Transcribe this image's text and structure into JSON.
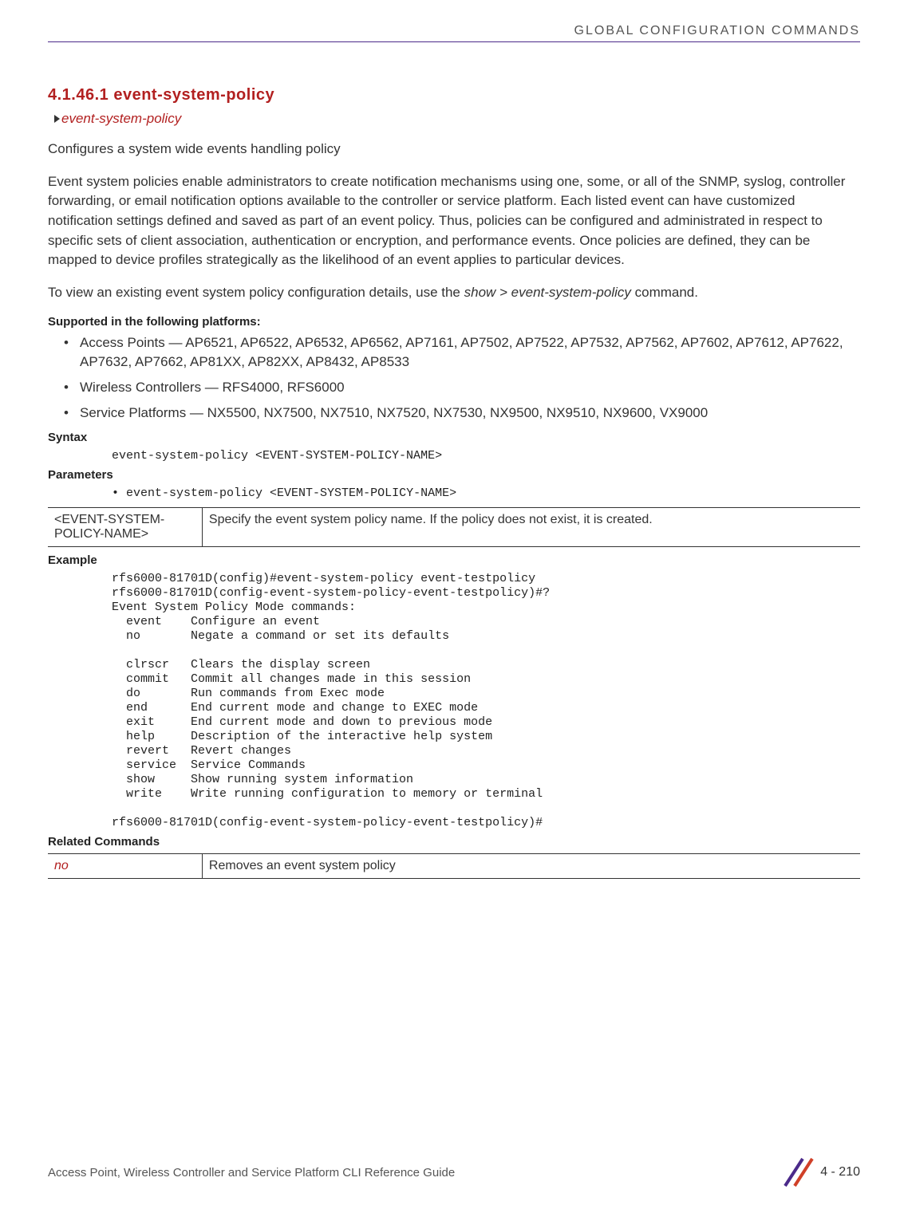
{
  "header": {
    "right": "GLOBAL CONFIGURATION COMMANDS"
  },
  "section": {
    "number_title": "4.1.46.1 event-system-policy",
    "breadcrumb": "event-system-policy",
    "intro1": "Configures a system wide events handling policy",
    "intro2": "Event system policies enable administrators to create notification mechanisms using one, some, or all of the SNMP, syslog, controller forwarding, or email notification options available to the controller or service platform. Each listed event can have customized notification settings defined and saved as part of an event policy. Thus, policies can be configured and administrated in respect to specific sets of client association, authentication or encryption, and performance events. Once policies are defined, they can be mapped to device profiles strategically as the likelihood of an event applies to particular devices.",
    "intro3_pre": "To view an existing event system policy configuration details, use the ",
    "intro3_italic": "show > event-system-policy",
    "intro3_post": " command."
  },
  "supported": {
    "heading": "Supported in the following platforms:",
    "items": [
      "Access Points — AP6521, AP6522, AP6532, AP6562, AP7161, AP7502, AP7522, AP7532, AP7562, AP7602, AP7612, AP7622, AP7632, AP7662, AP81XX, AP82XX, AP8432, AP8533",
      "Wireless Controllers — RFS4000, RFS6000",
      "Service Platforms — NX5500, NX7500, NX7510, NX7520, NX7530, NX9500, NX9510, NX9600, VX9000"
    ]
  },
  "syntax": {
    "heading": "Syntax",
    "line": "event-system-policy <EVENT-SYSTEM-POLICY-NAME>"
  },
  "parameters": {
    "heading": "Parameters",
    "bullet": "event-system-policy <EVENT-SYSTEM-POLICY-NAME>",
    "table": {
      "param": "<EVENT-SYSTEM-POLICY-NAME>",
      "desc": "Specify the event system policy name. If the policy does not exist, it is created."
    }
  },
  "example": {
    "heading": "Example",
    "block": "rfs6000-81701D(config)#event-system-policy event-testpolicy\nrfs6000-81701D(config-event-system-policy-event-testpolicy)#?\nEvent System Policy Mode commands:\n  event    Configure an event\n  no       Negate a command or set its defaults\n\n  clrscr   Clears the display screen\n  commit   Commit all changes made in this session\n  do       Run commands from Exec mode\n  end      End current mode and change to EXEC mode\n  exit     End current mode and down to previous mode\n  help     Description of the interactive help system\n  revert   Revert changes\n  service  Service Commands\n  show     Show running system information\n  write    Write running configuration to memory or terminal\n\nrfs6000-81701D(config-event-system-policy-event-testpolicy)#"
  },
  "related": {
    "heading": "Related Commands",
    "table": {
      "cmd": "no",
      "desc": "Removes an event system policy"
    }
  },
  "footer": {
    "left": "Access Point, Wireless Controller and Service Platform CLI Reference Guide",
    "page": "4 - 210"
  }
}
